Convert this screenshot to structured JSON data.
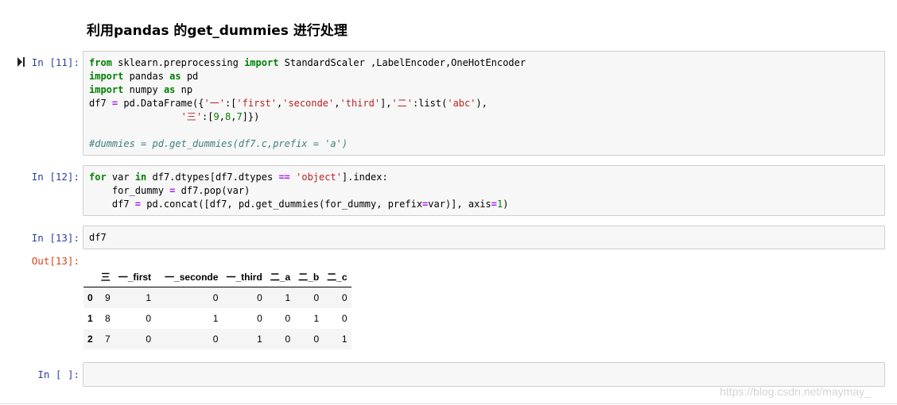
{
  "heading": "利用pandas 的get_dummies 进行处理",
  "cells": [
    {
      "prompt": "In  [11]:"
    },
    {
      "prompt": "In  [12]:"
    },
    {
      "prompt": "In  [13]:",
      "code": "df7"
    },
    {
      "prompt": "In  [  ]:"
    }
  ],
  "output": {
    "prompt": "Out[13]:",
    "columns": [
      "",
      "三",
      "一_first",
      "一_seconde",
      "一_third",
      "二_a",
      "二_b",
      "二_c"
    ],
    "rows": [
      [
        "0",
        "9",
        "1",
        "0",
        "0",
        "1",
        "0",
        "0"
      ],
      [
        "1",
        "8",
        "0",
        "1",
        "0",
        "0",
        "1",
        "0"
      ],
      [
        "2",
        "7",
        "0",
        "0",
        "1",
        "0",
        "0",
        "1"
      ]
    ]
  },
  "code": {
    "c11": {
      "l1_from": "from",
      "l1_mod": " sklearn.preprocessing ",
      "l1_import": "import",
      "l1_rest": " StandardScaler ,LabelEncoder,OneHotEncoder",
      "l2_import": "import",
      "l2_mod": " pandas ",
      "l2_as": "as",
      "l2_rest": " pd",
      "l3_import": "import",
      "l3_mod": " numpy ",
      "l3_as": "as",
      "l3_rest": " np",
      "l4_a": "df7 ",
      "l4_eq": "=",
      "l4_b": " pd.DataFrame({",
      "l4_s1": "'一'",
      "l4_c": ":[",
      "l4_s2": "'first'",
      "l4_d": ",",
      "l4_s3": "'seconde'",
      "l4_e": ",",
      "l4_s4": "'third'",
      "l4_f": "],",
      "l4_s5": "'二'",
      "l4_g": ":list(",
      "l4_s6": "'abc'",
      "l4_h": "),",
      "l5_indent": "                ",
      "l5_s": "'三'",
      "l5_a": ":[",
      "l5_n1": "9",
      "l5_c1": ",",
      "l5_n2": "8",
      "l5_c2": ",",
      "l5_n3": "7",
      "l5_end": "]})",
      "l7_comment": "#dummies = pd.get_dummies(df7.c,prefix = 'a')"
    },
    "c12": {
      "l1_for": "for",
      "l1_a": " var ",
      "l1_in": "in",
      "l1_b": " df7.dtypes[df7.dtypes ",
      "l1_eq": "==",
      "l1_sp": " ",
      "l1_s": "'object'",
      "l1_c": "].index:",
      "l2_a": "    for_dummy ",
      "l2_eq": "=",
      "l2_b": " df7.pop(var)",
      "l3_a": "    df7 ",
      "l3_eq": "=",
      "l3_b": " pd.concat([df7, pd.get_dummies(for_dummy, prefix",
      "l3_eq2": "=",
      "l3_c": "var)], axis",
      "l3_eq3": "=",
      "l3_n": "1",
      "l3_d": ")"
    }
  },
  "watermark": "https://blog.csdn.net/maymay_"
}
